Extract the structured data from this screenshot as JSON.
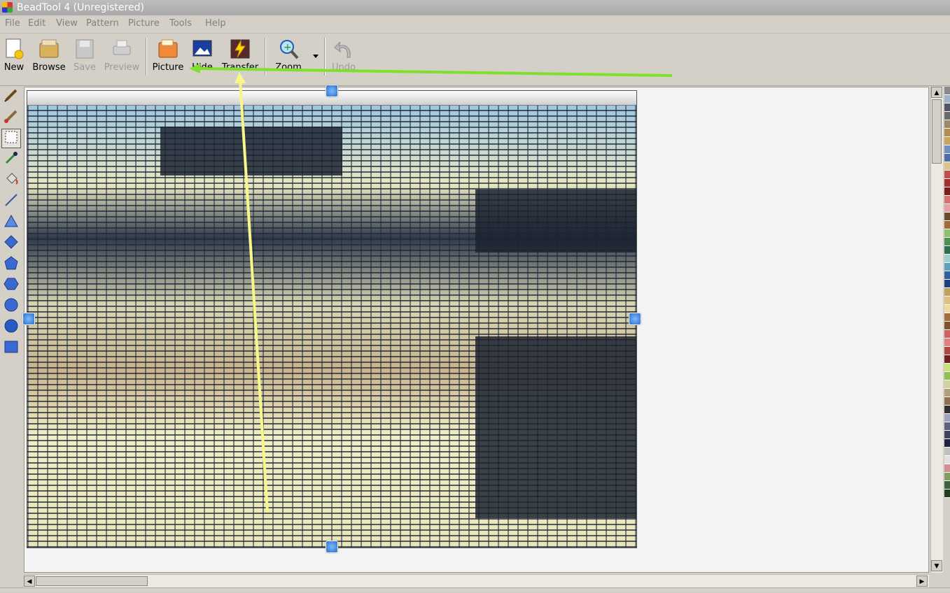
{
  "window": {
    "title": "BeadTool 4 (Unregistered)"
  },
  "menu": [
    "File",
    "Edit",
    "View",
    "Pattern",
    "Picture",
    "Tools",
    "Help"
  ],
  "toolbar": {
    "new": "New",
    "browse": "Browse",
    "save": "Save",
    "preview": "Preview",
    "picture": "Picture",
    "hide": "Hide",
    "transfer": "Transfer",
    "zoom": "Zoom",
    "undo": "Undo"
  },
  "tools": [
    "pencil-icon",
    "brush-icon",
    "select-rectangle-icon",
    "eyedropper-icon",
    "fill-bucket-icon",
    "line-icon",
    "triangle-icon",
    "diamond-icon",
    "pentagon-icon",
    "hexagon-icon",
    "circle-icon",
    "ellipse-icon",
    "rectangle-icon"
  ],
  "palette_colors": [
    "#8a8a8a",
    "#a0b4c8",
    "#555566",
    "#6b6b6b",
    "#9c8a6a",
    "#b78b4f",
    "#c9a45c",
    "#6f8fbf",
    "#4a6fa8",
    "#d9c48f",
    "#c05050",
    "#a82f2f",
    "#7a1f1f",
    "#d87070",
    "#e4a0a0",
    "#6c4a2e",
    "#a06a3b",
    "#8fbf6f",
    "#4f8f4f",
    "#2f6f4f",
    "#9fd0d0",
    "#5fa0c0",
    "#2f5fa0",
    "#1f3f80",
    "#c0a060",
    "#e0c080",
    "#f0d8a0",
    "#a07040",
    "#805030",
    "#d06060",
    "#e08080",
    "#b04848",
    "#702020",
    "#c8e078",
    "#90c050",
    "#d0d0a0",
    "#b0a080",
    "#907050",
    "#303030",
    "#a0a0c0",
    "#606080",
    "#404060",
    "#202040",
    "#c0c0c0",
    "#e0e0e0",
    "#d09090",
    "#80a060",
    "#406040",
    "#204020"
  ],
  "colors": {
    "arrow_green": "#7ee02a",
    "arrow_yellow": "#f7f78a"
  }
}
